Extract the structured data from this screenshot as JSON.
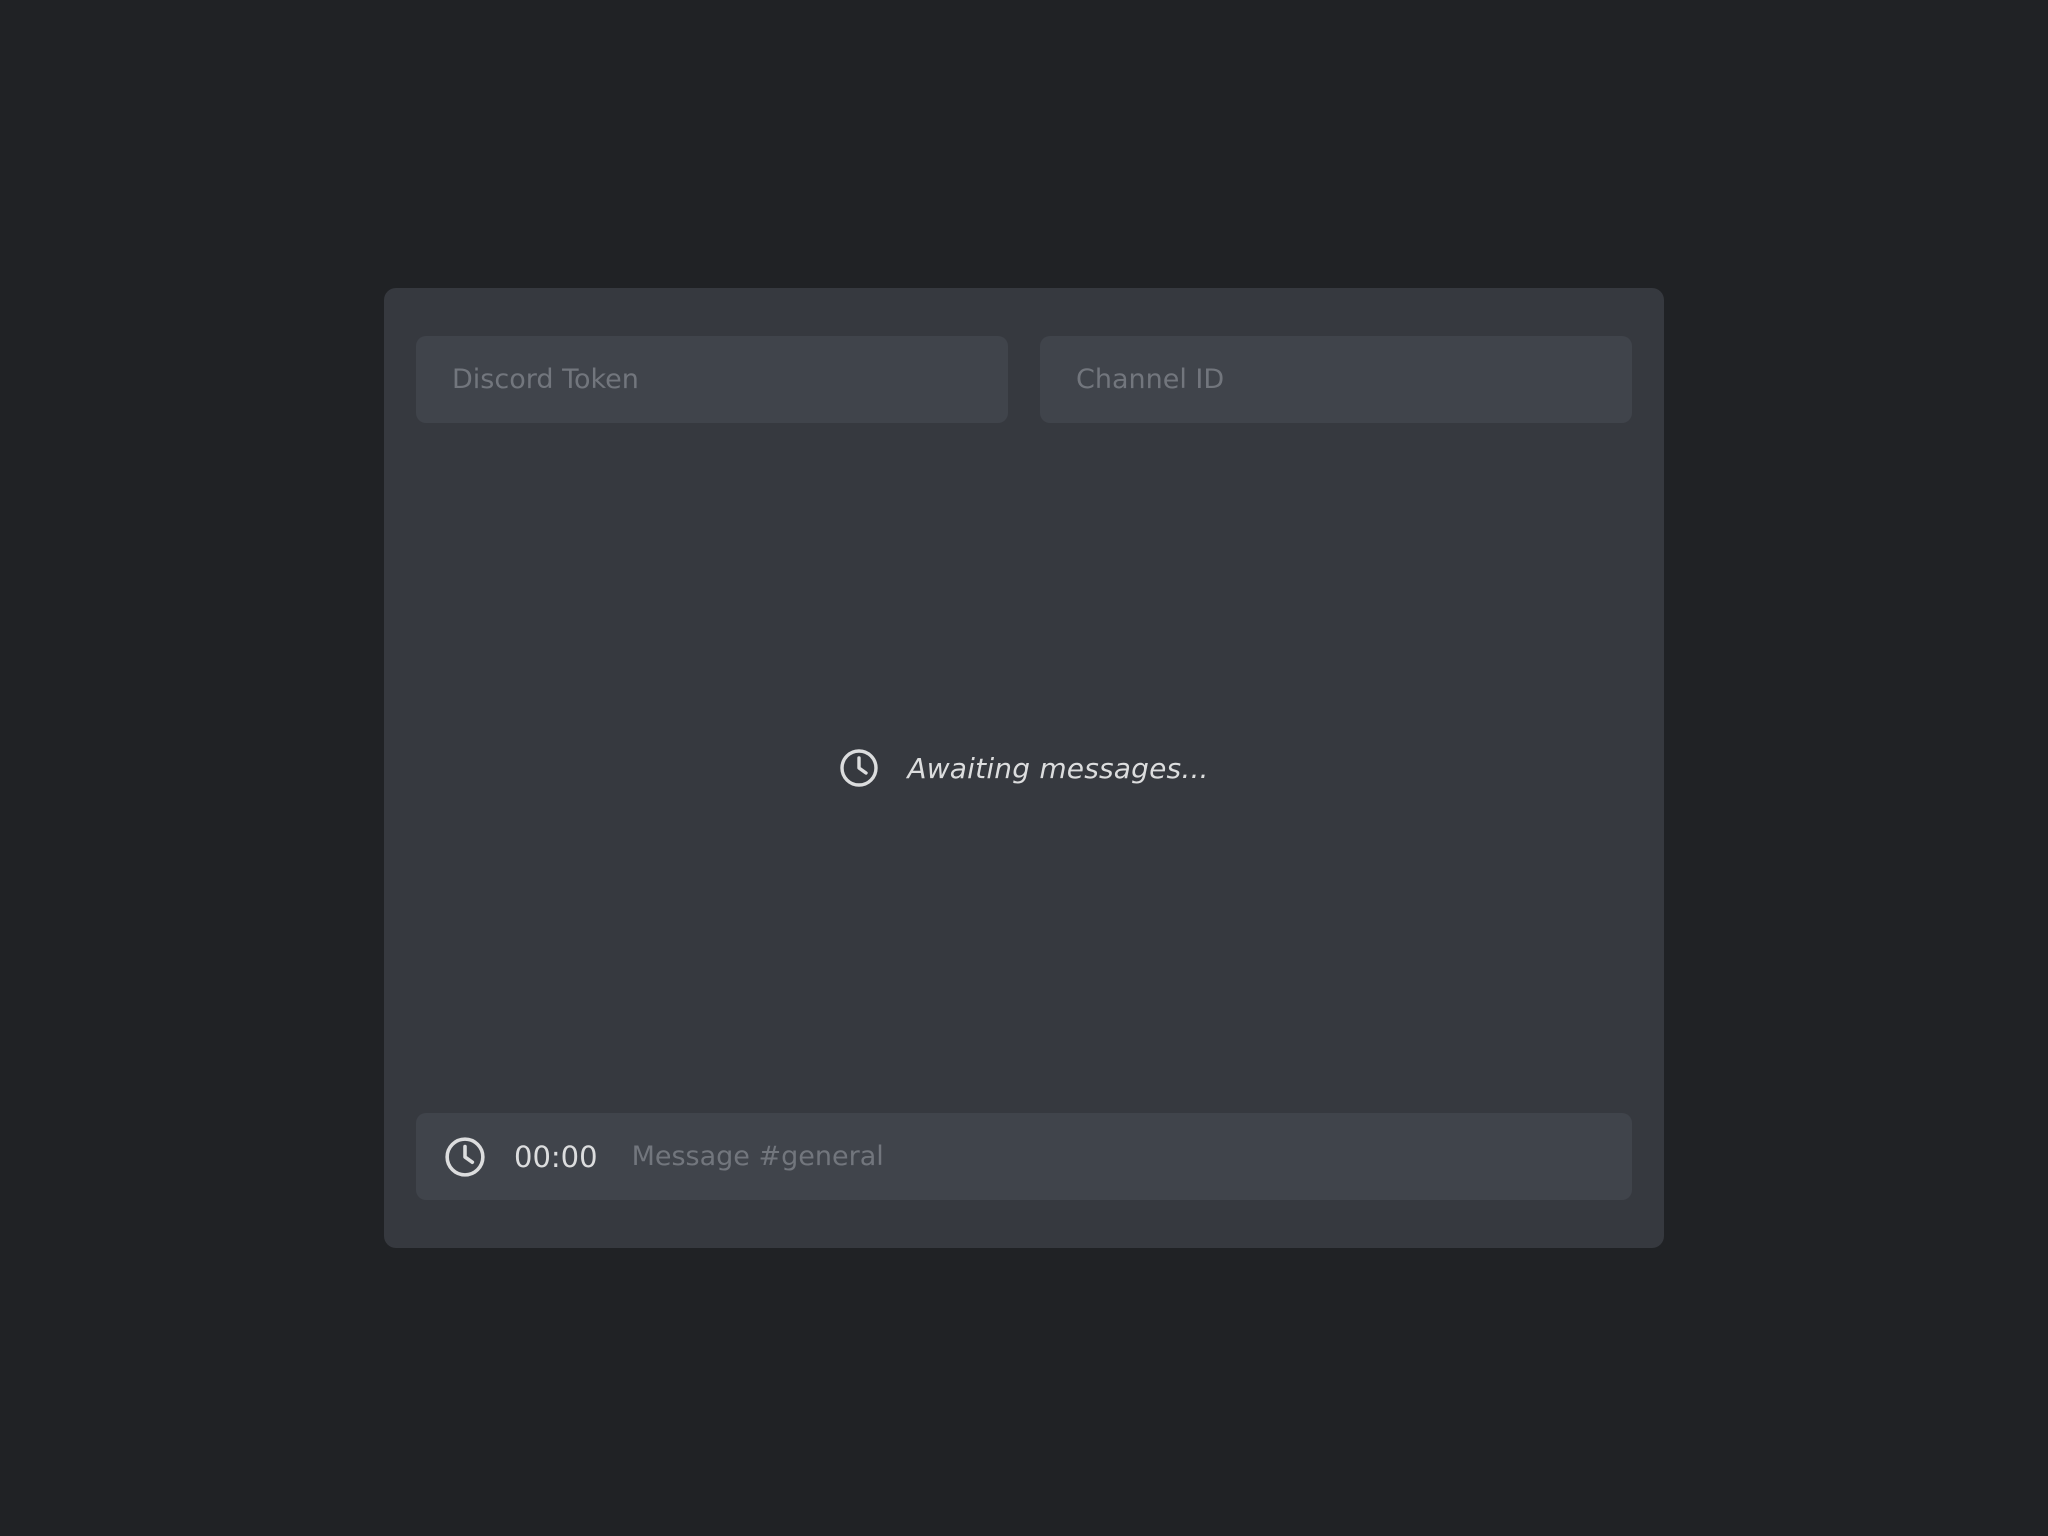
{
  "colors": {
    "page_background": "#202225",
    "panel_background": "#36393f",
    "field_background": "#40444b",
    "placeholder_text": "#72767d",
    "primary_text": "#dcddde"
  },
  "config": {
    "token_input": {
      "value": "",
      "placeholder": "Discord Token"
    },
    "channel_input": {
      "value": "",
      "placeholder": "Channel ID"
    }
  },
  "messages": {
    "status_icon": "clock-icon",
    "empty_text": "Awaiting messages..."
  },
  "composer": {
    "timer_icon": "clock-icon",
    "timer_text": "00:00",
    "message_input": {
      "value": "",
      "placeholder": "Message #general"
    }
  }
}
